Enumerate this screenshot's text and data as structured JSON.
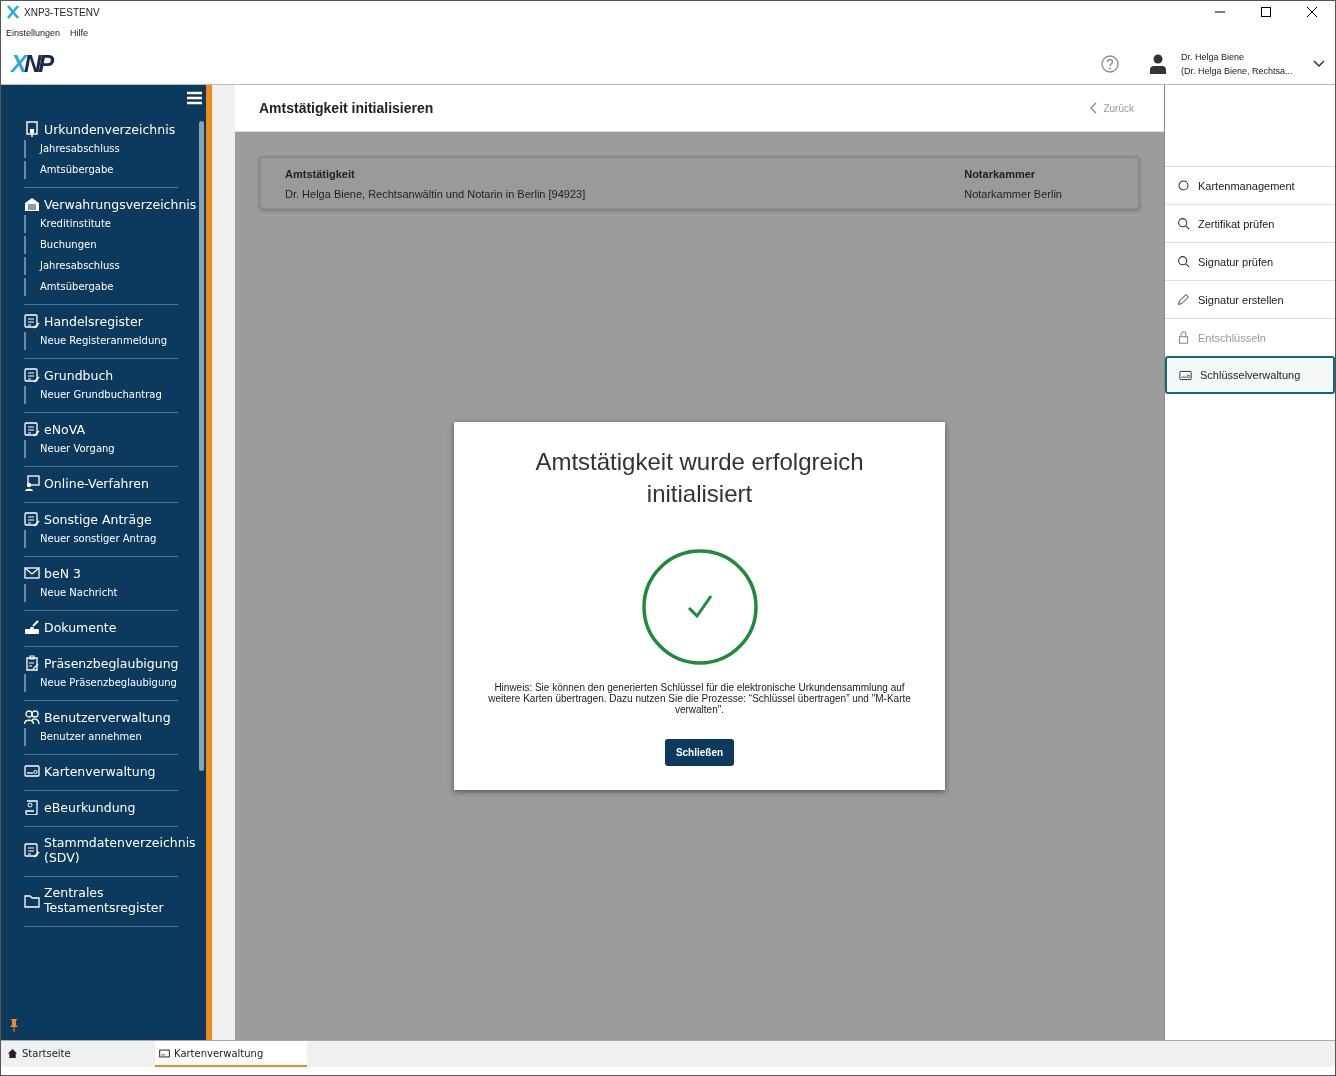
{
  "window": {
    "title": "XNP3-TESTENV"
  },
  "menu": [
    "Einstellungen",
    "Hilfe"
  ],
  "logo": {
    "text": "XNP"
  },
  "user": {
    "name": "Dr. Helga Biene",
    "role": "(Dr. Helga Biene, Rechtsa..."
  },
  "sidebar": {
    "groups": [
      {
        "title": "Urkundenverzeichnis",
        "items": [
          "Jahresabschluss",
          "Amtsübergabe"
        ]
      },
      {
        "title": "Verwahrungsverzeichnis",
        "items": [
          "Kreditinstitute",
          "Buchungen",
          "Jahresabschluss",
          "Amtsübergabe"
        ]
      },
      {
        "title": "Handelsregister",
        "items": [
          "Neue Registeranmeldung"
        ]
      },
      {
        "title": "Grundbuch",
        "items": [
          "Neuer Grundbuchantrag"
        ]
      },
      {
        "title": "eNoVA",
        "items": [
          "Neuer Vorgang"
        ]
      },
      {
        "title": "Online-Verfahren"
      },
      {
        "title": "Sonstige Anträge",
        "items": [
          "Neuer sonstiger Antrag"
        ]
      },
      {
        "title": "beN 3",
        "items": [
          "Neue Nachricht"
        ]
      },
      {
        "title": "Dokumente"
      },
      {
        "title": "Präsenzbeglaubigung",
        "items": [
          "Neue Präsenzbeglaubigung"
        ]
      },
      {
        "title": "Benutzerverwaltung",
        "items": [
          "Benutzer annehmen"
        ]
      },
      {
        "title": "Kartenverwaltung"
      },
      {
        "title": "eBeurkundung"
      },
      {
        "title": "Stammdatenverzeichnis (SDV)"
      },
      {
        "title": "Zentrales Testamentsregister"
      }
    ]
  },
  "page": {
    "title": "Amtstätigkeit initialisieren",
    "back": "Zurück"
  },
  "info_card": {
    "fields": [
      {
        "label": "Amtstätigkeit",
        "value": "Dr. Helga Biene, Rechtsanwältin und Notarin in Berlin [94923]"
      },
      {
        "label": "Notarkammer",
        "value": "Notarkammer Berlin"
      }
    ]
  },
  "dialog": {
    "title": "Amtstätigkeit wurde erfolgreich initialisiert",
    "hint": "Hinweis: Sie können den generierten Schlüssel für die elektronische Urkundensammlung auf weitere Karten übertragen. Dazu nutzen Sie die Prozesse: “Schlüssel übertragen” und \"M-Karte verwalten\".",
    "button": "Schließen"
  },
  "actions": [
    {
      "label": "Kartenmanagement",
      "disabled": false,
      "selected": false
    },
    {
      "label": "Zertifikat prüfen",
      "disabled": false,
      "selected": false
    },
    {
      "label": "Signatur prüfen",
      "disabled": false,
      "selected": false
    },
    {
      "label": "Signatur erstellen",
      "disabled": false,
      "selected": false
    },
    {
      "label": "Entschlüsseln",
      "disabled": true,
      "selected": false
    },
    {
      "label": "Schlüsselverwaltung",
      "disabled": false,
      "selected": true
    }
  ],
  "bottom_tabs": [
    {
      "label": "Startseite",
      "selected": false
    },
    {
      "label": "Kartenverwaltung",
      "selected": true
    }
  ]
}
